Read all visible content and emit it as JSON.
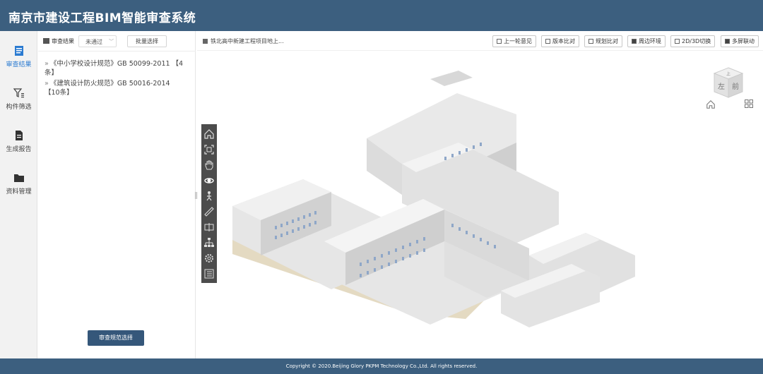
{
  "app": {
    "title": "南京市建设工程BIM智能审查系统"
  },
  "nav": {
    "items": [
      {
        "label": "审查结果",
        "icon": "list-icon",
        "active": true
      },
      {
        "label": "构件筛选",
        "icon": "filter-icon",
        "active": false
      },
      {
        "label": "生成报告",
        "icon": "report-icon",
        "active": false
      },
      {
        "label": "资料管理",
        "icon": "folder-icon",
        "active": false
      }
    ]
  },
  "panel": {
    "header_label": "审查结果",
    "status_select": "未通过",
    "batch_button": "批量选择",
    "rules": [
      {
        "text": "《中小学校设计规范》GB 50099-2011 【4条】"
      },
      {
        "text": "《建筑设计防火规范》GB 50016-2014 【10条】"
      }
    ],
    "footer_button": "审查规范选择"
  },
  "viewer": {
    "project_title": "铁北高中新建工程项目地上...",
    "toolbar": [
      {
        "label": "上一轮意见",
        "icon": "prev-opinion-icon"
      },
      {
        "label": "版本比对",
        "icon": "version-compare-icon"
      },
      {
        "label": "规划比对",
        "icon": "plan-compare-icon"
      },
      {
        "label": "周边环境",
        "icon": "surroundings-icon"
      },
      {
        "label": "2D/3D切换",
        "icon": "dimension-switch-icon"
      },
      {
        "label": "多屏联动",
        "icon": "multiscreen-icon"
      }
    ],
    "viewcube": {
      "left_face": "左",
      "front_face": "前",
      "top_face": "上"
    },
    "tools": [
      "home-icon",
      "fit-view-icon",
      "pan-hand-icon",
      "orbit-icon",
      "walk-icon",
      "measure-icon",
      "section-icon",
      "structure-tree-icon",
      "settings-icon",
      "properties-icon"
    ]
  },
  "footer": {
    "copyright": "Copyright © 2020.Beijing Glory PKPM Technology Co.,Ltd. All rights reserved."
  },
  "colors": {
    "header": "#3c5f7f",
    "accent": "#2b7bd1",
    "primary_button": "#35577a",
    "toolstrip": "#4c4c4c"
  }
}
